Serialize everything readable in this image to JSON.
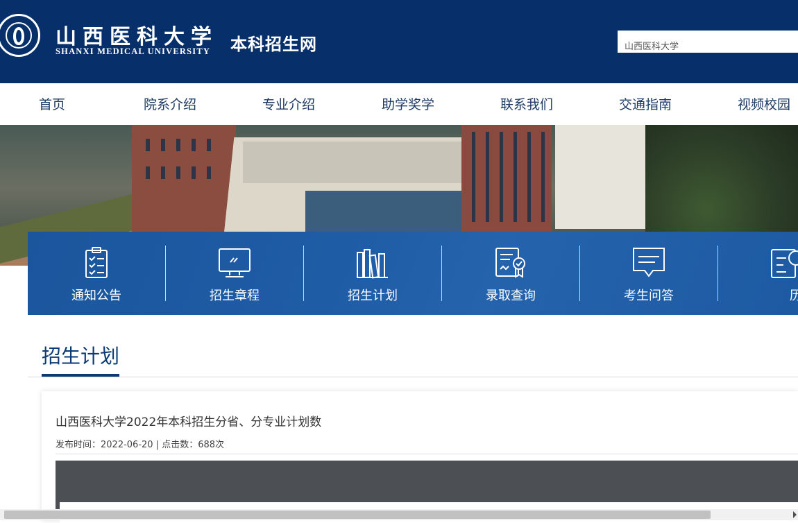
{
  "header": {
    "university_cn": "山西医科大学",
    "university_en": "SHANXI MEDICAL UNIVERSITY",
    "site_title": "本科招生网",
    "search_value": "山西医科大学",
    "logo_icon": "university-emblem"
  },
  "nav": {
    "items": [
      {
        "label": "首页"
      },
      {
        "label": "院系介绍"
      },
      {
        "label": "专业介绍"
      },
      {
        "label": "助学奖学"
      },
      {
        "label": "联系我们"
      },
      {
        "label": "交通指南"
      },
      {
        "label": "视频校园"
      }
    ]
  },
  "quick_links": [
    {
      "label": "通知公告",
      "icon": "clipboard-checklist-icon"
    },
    {
      "label": "招生章程",
      "icon": "monitor-icon"
    },
    {
      "label": "招生计划",
      "icon": "books-icon"
    },
    {
      "label": "录取查询",
      "icon": "certificate-icon"
    },
    {
      "label": "考生问答",
      "icon": "chat-bubble-icon"
    },
    {
      "label": "历年分",
      "icon": "calendar-clock-icon"
    }
  ],
  "section": {
    "title": "招生计划"
  },
  "article": {
    "title": "山西医科大学2022年本科招生分省、分专业计划数",
    "meta": "发布时间：2022-06-20 | 点击数：688次"
  },
  "colors": {
    "header_bg": "#07306a",
    "nav_text": "#1d3a63",
    "quick_bar": "#1e5ca5",
    "accent": "#0a3a73"
  }
}
